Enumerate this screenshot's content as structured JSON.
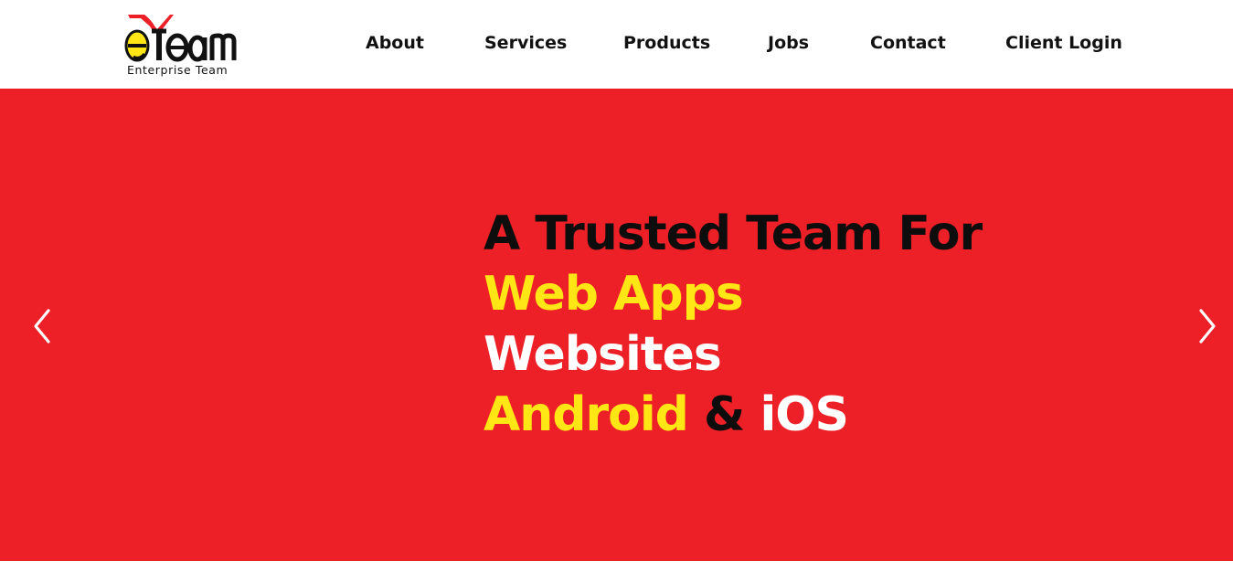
{
  "brand": {
    "logo_word": "eTeam",
    "tagline": "Enterprise Team"
  },
  "nav": {
    "items": [
      {
        "label": "About"
      },
      {
        "label": "Services"
      },
      {
        "label": "Products"
      },
      {
        "label": "Jobs"
      },
      {
        "label": "Contact"
      },
      {
        "label": "Client Login"
      }
    ]
  },
  "hero": {
    "line1": "A Trusted Team For",
    "line2": "Web Apps",
    "line3": "Websites",
    "line4_part1": "Android",
    "line4_part2": " & ",
    "line4_part3": "iOS",
    "prev_icon": "chevron-left-icon",
    "next_icon": "chevron-right-icon"
  },
  "colors": {
    "hero_background": "#ed2027",
    "accent_yellow": "#ffe614",
    "text_dark": "#0d0d0d",
    "text_white": "#ffffff"
  }
}
